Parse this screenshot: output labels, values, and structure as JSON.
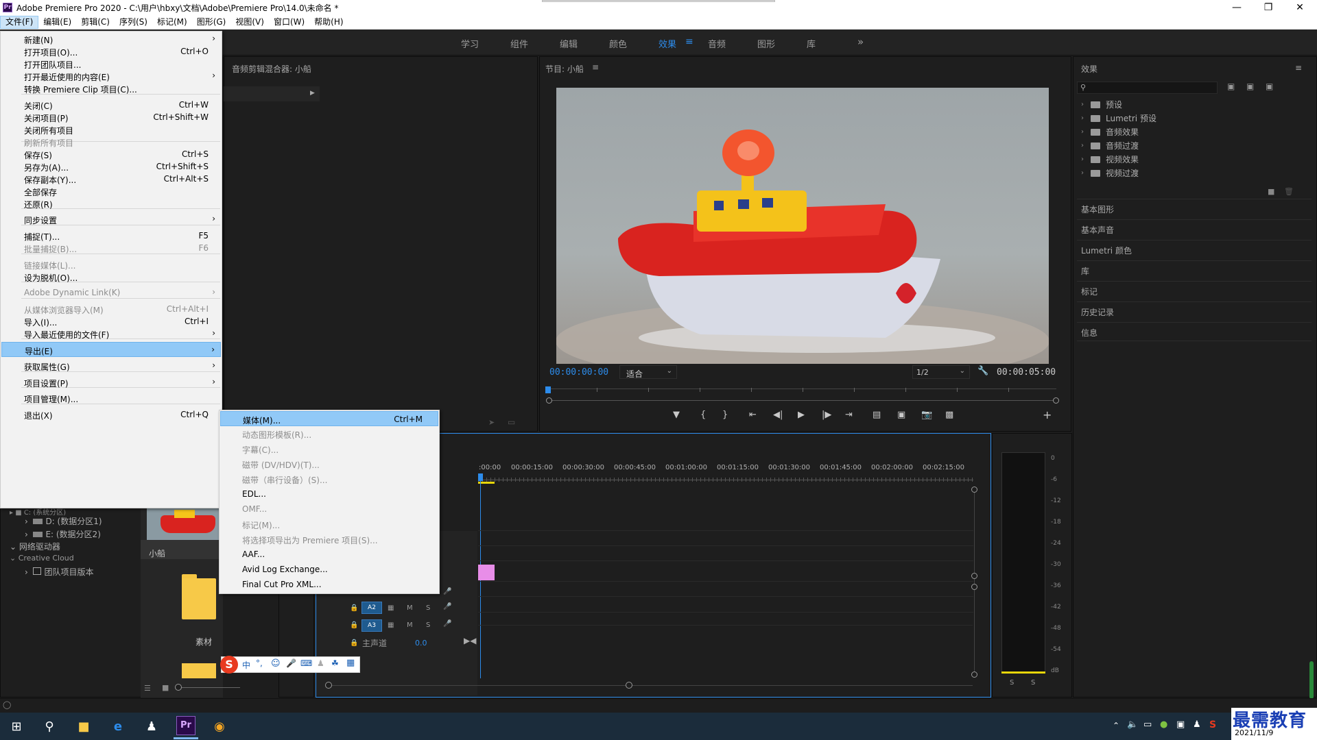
{
  "window": {
    "title": "Adobe Premiere Pro 2020 - C:\\用户\\hbxy\\文档\\Adobe\\Premiere Pro\\14.0\\未命名 *",
    "app_icon": "Pr"
  },
  "menubar": [
    {
      "label": "文件(F)",
      "active": true
    },
    {
      "label": "编辑(E)"
    },
    {
      "label": "剪辑(C)"
    },
    {
      "label": "序列(S)"
    },
    {
      "label": "标记(M)"
    },
    {
      "label": "图形(G)"
    },
    {
      "label": "视图(V)"
    },
    {
      "label": "窗口(W)"
    },
    {
      "label": "帮助(H)"
    }
  ],
  "workspaces": [
    "学习",
    "组件",
    "编辑",
    "颜色",
    "效果",
    "音频",
    "图形",
    "库"
  ],
  "workspace_active": "效果",
  "file_menu": [
    {
      "label": "新建(N)",
      "shortcut": "",
      "submenu": true
    },
    {
      "label": "打开项目(O)...",
      "shortcut": "Ctrl+O"
    },
    {
      "label": "打开团队项目..."
    },
    {
      "label": "打开最近使用的内容(E)",
      "submenu": true
    },
    {
      "label": "转换 Premiere Clip 项目(C)..."
    },
    {
      "label": "关闭(C)",
      "shortcut": "Ctrl+W"
    },
    {
      "label": "关闭项目(P)",
      "shortcut": "Ctrl+Shift+W"
    },
    {
      "label": "关闭所有项目"
    },
    {
      "label": "刷新所有项目",
      "disabled": true
    },
    {
      "label": "保存(S)",
      "shortcut": "Ctrl+S"
    },
    {
      "label": "另存为(A)...",
      "shortcut": "Ctrl+Shift+S"
    },
    {
      "label": "保存副本(Y)...",
      "shortcut": "Ctrl+Alt+S"
    },
    {
      "label": "全部保存"
    },
    {
      "label": "还原(R)"
    },
    {
      "label": "同步设置",
      "submenu": true
    },
    {
      "label": "捕捉(T)...",
      "shortcut": "F5"
    },
    {
      "label": "批量捕捉(B)...",
      "shortcut": "F6",
      "disabled": true
    },
    {
      "label": "链接媒体(L)...",
      "disabled": true
    },
    {
      "label": "设为脱机(O)..."
    },
    {
      "label": "Adobe Dynamic Link(K)",
      "submenu": true,
      "disabled": true
    },
    {
      "label": "从媒体浏览器导入(M)",
      "shortcut": "Ctrl+Alt+I",
      "disabled": true
    },
    {
      "label": "导入(I)...",
      "shortcut": "Ctrl+I"
    },
    {
      "label": "导入最近使用的文件(F)",
      "submenu": true
    },
    {
      "label": "导出(E)",
      "submenu": true,
      "highlighted": true
    },
    {
      "label": "获取属性(G)",
      "submenu": true
    },
    {
      "label": "项目设置(P)",
      "submenu": true
    },
    {
      "label": "项目管理(M)..."
    },
    {
      "label": "退出(X)",
      "shortcut": "Ctrl+Q"
    }
  ],
  "export_menu": [
    {
      "label": "媒体(M)...",
      "shortcut": "Ctrl+M",
      "highlighted": true
    },
    {
      "label": "动态图形模板(R)...",
      "disabled": true
    },
    {
      "label": "字幕(C)...",
      "disabled": true
    },
    {
      "label": "磁带 (DV/HDV)(T)...",
      "disabled": true
    },
    {
      "label": "磁带（串行设备）(S)...",
      "disabled": true
    },
    {
      "label": "EDL..."
    },
    {
      "label": "OMF...",
      "disabled": true
    },
    {
      "label": "标记(M)...",
      "disabled": true
    },
    {
      "label": "将选择项导出为 Premiere 项目(S)...",
      "disabled": true
    },
    {
      "label": "AAF..."
    },
    {
      "label": "Avid Log Exchange..."
    },
    {
      "label": "Final Cut Pro XML..."
    }
  ],
  "audio_mixer_title": "音频剪辑混合器: 小船",
  "program_monitor": {
    "title": "节目: 小船",
    "timecode_current": "00:00:00:00",
    "timecode_duration": "00:00:05:00",
    "fit_label": "适合",
    "resolution": "1/2"
  },
  "effects_panel": {
    "title": "效果",
    "search_placeholder": "",
    "items": [
      "预设",
      "Lumetri 预设",
      "音频效果",
      "音频过渡",
      "视频效果",
      "视频过渡"
    ],
    "sections": [
      "基本图形",
      "基本声音",
      "Lumetri 颜色",
      "库",
      "标记",
      "历史记录",
      "信息"
    ]
  },
  "project_panel": {
    "drives": [
      "D: (数据分区1)",
      "E: (数据分区2)"
    ],
    "network": "网络驱动器",
    "creative_cloud": "Creative Cloud",
    "team": "团队项目版本",
    "clip_name": "小船",
    "bin_name": "素材"
  },
  "timeline": {
    "ruler": [
      ":00:00",
      "00:00:15:00",
      "00:00:30:00",
      "00:00:45:00",
      "00:01:00:00",
      "00:01:15:00",
      "00:01:30:00",
      "00:01:45:00",
      "00:02:00:00",
      "00:02:15:00"
    ],
    "tracks": [
      "A2",
      "A3"
    ],
    "master_label": "主声道",
    "master_value": "0.0",
    "btn_m": "M",
    "btn_s": "S"
  },
  "meter": {
    "labels": [
      "0",
      "-6",
      "-12",
      "-18",
      "-24",
      "-30",
      "-36",
      "-42",
      "-48",
      "-54",
      "dB"
    ],
    "solo": [
      "S",
      "S"
    ]
  },
  "ime": {
    "label": "中"
  },
  "taskbar": {
    "date": "2021/11/9",
    "watermark": "最需教育"
  },
  "colors": {
    "accent": "#2d8ceb",
    "menu_highlight": "#91c9f7",
    "clip_pink": "#e88de8",
    "selection_border": "#2d8ceb"
  }
}
